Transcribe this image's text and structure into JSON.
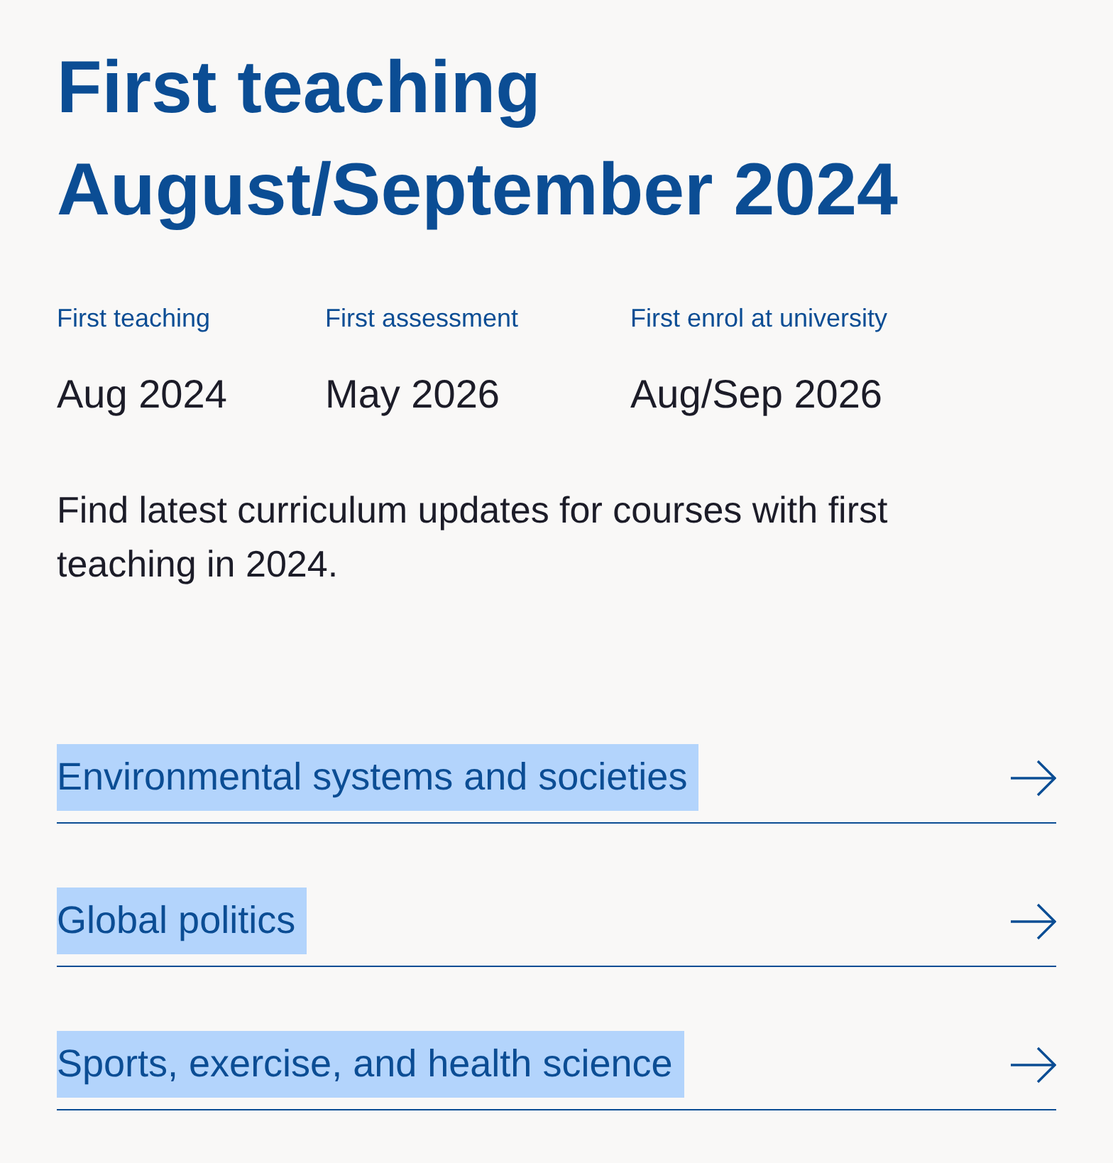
{
  "heading": "First teaching August/September 2024",
  "dates": [
    {
      "label": "First teaching",
      "value": "Aug 2024"
    },
    {
      "label": "First assessment",
      "value": "May 2026"
    },
    {
      "label": "First enrol at university",
      "value": "Aug/Sep 2026"
    }
  ],
  "description": "Find latest curriculum updates for courses with first teaching in 2024.",
  "links": [
    {
      "label": "Environmental systems and societies",
      "highlighted": true
    },
    {
      "label": "Global politics",
      "highlighted": true
    },
    {
      "label": "Sports, exercise, and health science",
      "highlighted": true
    }
  ]
}
